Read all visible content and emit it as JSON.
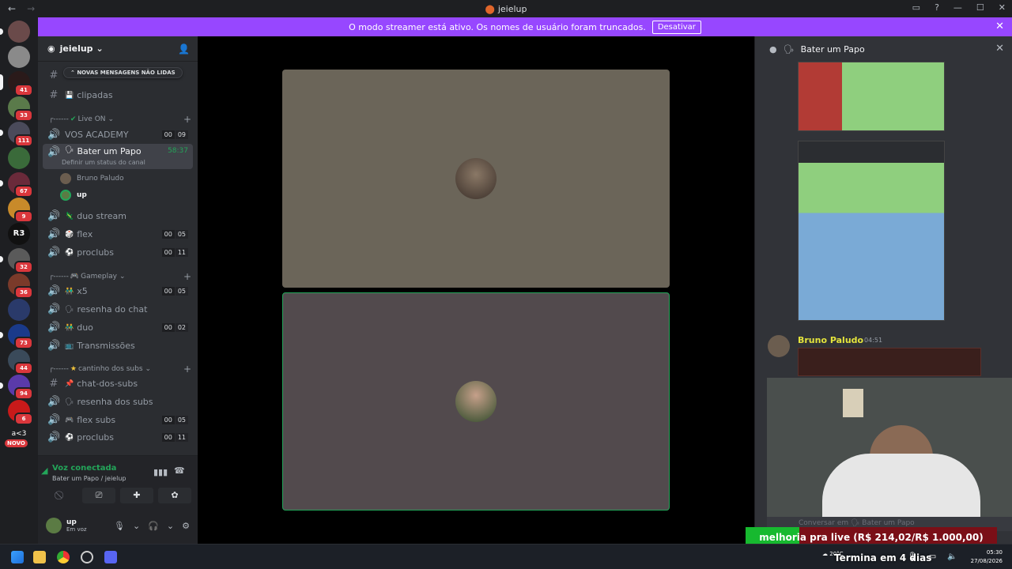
{
  "window": {
    "title": "jeielup"
  },
  "banner": {
    "text": "O modo streamer está ativo. Os nomes de usuário foram truncados.",
    "button": "Desativar"
  },
  "servers": [
    {
      "badge": ""
    },
    {
      "badge": ""
    },
    {
      "badge": "41"
    },
    {
      "badge": "33"
    },
    {
      "badge": "111"
    },
    {
      "badge": ""
    },
    {
      "badge": "67"
    },
    {
      "badge": "9"
    },
    {
      "badge": ""
    },
    {
      "badge": "32"
    },
    {
      "badge": "36"
    },
    {
      "badge": ""
    },
    {
      "badge": "73"
    },
    {
      "badge": "44"
    },
    {
      "badge": "94"
    },
    {
      "badge": "6"
    }
  ],
  "server_r3": "R3",
  "server_a3": "a<3",
  "server_new": "NOVO",
  "sidebar": {
    "server_name": "jeielup",
    "new_messages": "NOVAS MENSAGENS NÃO LIDAS",
    "channels_top": [
      {
        "name": "clipadas",
        "emoji": "💾"
      }
    ],
    "category1": "Live ON",
    "category2": "Gameplay",
    "category3": "cantinho dos subs",
    "voice": [
      {
        "name": "VOS ACADEMY",
        "a": "00",
        "b": "09"
      },
      {
        "name": "duo stream",
        "emoji": "🦎"
      },
      {
        "name": "flex",
        "emoji": "🎲",
        "a": "00",
        "b": "05"
      },
      {
        "name": "proclubs",
        "emoji": "⚽",
        "a": "00",
        "b": "11"
      },
      {
        "name": "x5",
        "emoji": "👬",
        "a": "00",
        "b": "05"
      },
      {
        "name": "resenha do chat",
        "emoji": "🗣"
      },
      {
        "name": "duo",
        "emoji": "👬",
        "a": "00",
        "b": "02"
      },
      {
        "name": "Transmissões",
        "emoji": "📺"
      },
      {
        "name": "chat-dos-subs",
        "emoji": "📌"
      },
      {
        "name": "resenha dos subs",
        "emoji": "🗣"
      },
      {
        "name": "flex subs",
        "emoji": "🎮",
        "a": "00",
        "b": "05"
      },
      {
        "name": "proclubs",
        "emoji": "⚽",
        "a": "00",
        "b": "11"
      }
    ],
    "active": {
      "name": "Bater um Papo",
      "timer": "58:37",
      "status": "Definir um status do canal"
    },
    "members": [
      "Bruno Paludo",
      "up"
    ]
  },
  "voicebar": {
    "status": "Voz conectada",
    "location": "Bater um Papo / jeielup",
    "user": "up",
    "user_status": "Em voz"
  },
  "panel": {
    "title": "Bater um Papo",
    "author": "Bruno Paludo",
    "time": "04:51",
    "input_placeholder": "Conversar em 🗣 Bater um Papo"
  },
  "overlay": {
    "donation": "melhoria pra live (R$ 214,02/R$ 1.000,00)",
    "donation_progress": 0.214,
    "ends": "Termina em 4 dias"
  },
  "taskbar": {
    "temp": "20°C",
    "time": "05:30",
    "date": "27/08/2026"
  },
  "colors": {
    "accent": "#9747ff",
    "online": "#23a559"
  }
}
